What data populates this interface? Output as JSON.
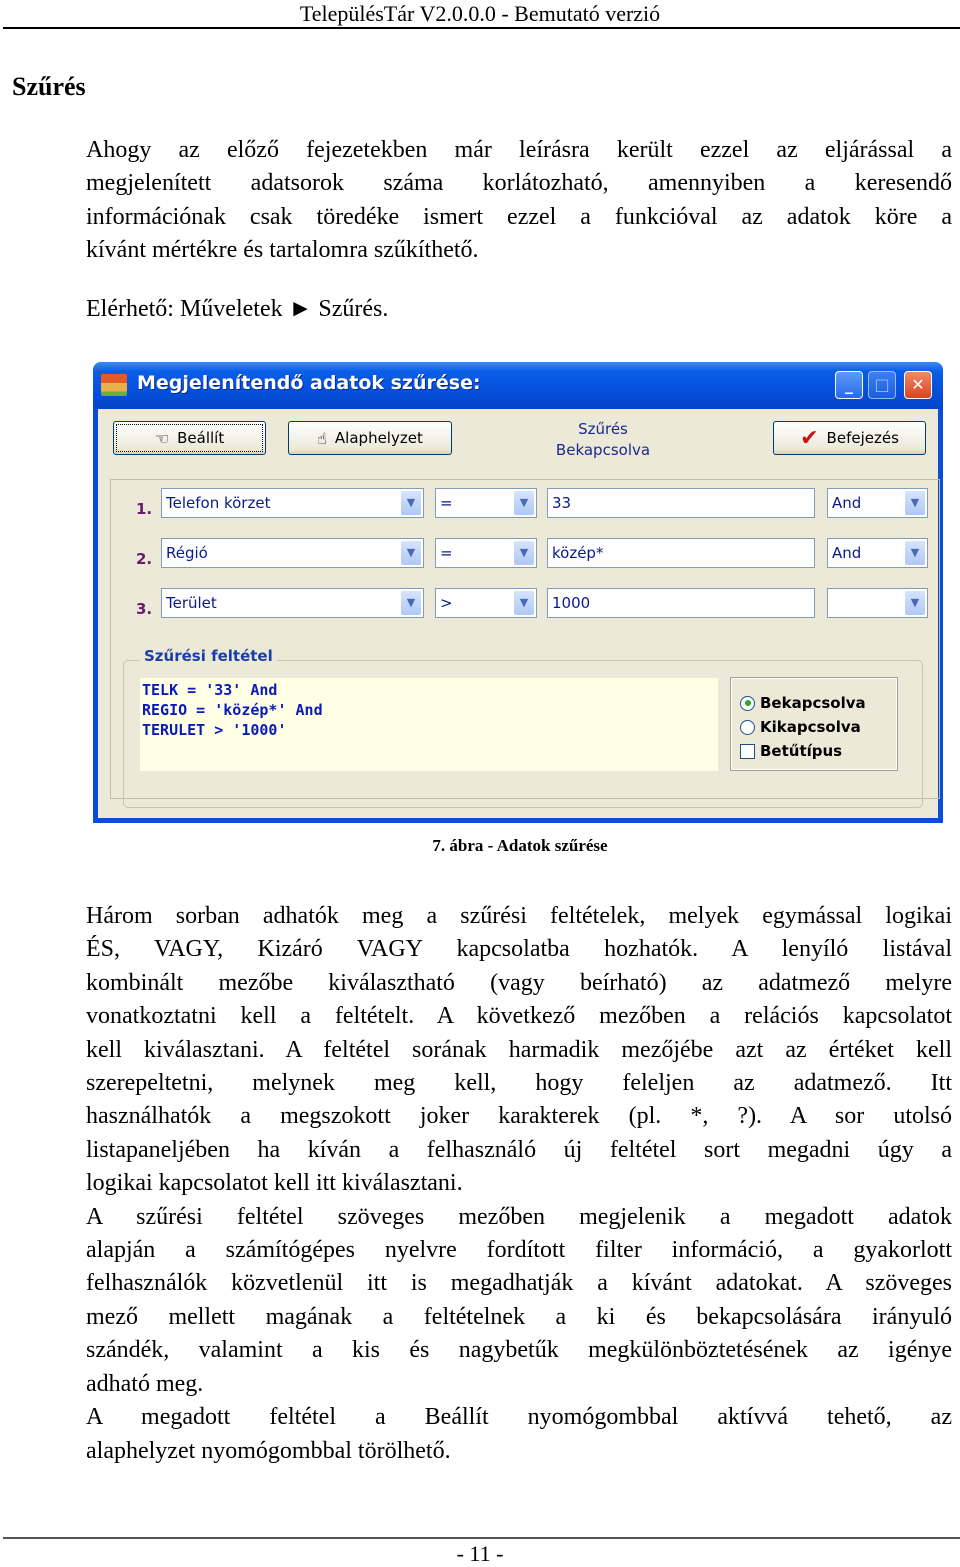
{
  "header": {
    "title": "TelepülésTár V2.0.0.0 - Bemutató verzió"
  },
  "section": {
    "title": "Szűrés"
  },
  "intro": {
    "lines": [
      "Ahogy az előző fejezetekben már leírásra került ezzel az eljárással a",
      "megjelenített adatsorok száma korlátozható, amennyiben a keresendő",
      "információnak csak töredéke ismert ezzel a funkcióval az adatok köre a",
      "kívánt mértékre és tartalomra szűkíthető."
    ],
    "access": "Elérhető: Műveletek ► Szűrés."
  },
  "dialog": {
    "title": "Megjelenítendő adatok szűrése:",
    "buttons": {
      "set": "Beállít",
      "reset": "Alaphelyzet",
      "done": "Befejezés"
    },
    "status": {
      "label": "Szűrés",
      "value": "Bekapcsolva"
    },
    "rows": [
      {
        "num": "1.",
        "field": "Telefon körzet",
        "op": "=",
        "value": "33",
        "logic": "And"
      },
      {
        "num": "2.",
        "field": "Régió",
        "op": "=",
        "value": "közép*",
        "logic": "And"
      },
      {
        "num": "3.",
        "field": "Terület",
        "op": ">",
        "value": "1000",
        "logic": ""
      }
    ],
    "filter_group": {
      "label": "Szűrési feltétel",
      "lines": [
        "TELK = '33' And",
        "REGIO = 'közép*' And",
        "TERULET > '1000'"
      ],
      "options": {
        "on": "Bekapcsolva",
        "off": "Kikapcsolva",
        "font": "Betűtípus"
      },
      "selected": "on",
      "font_checked": false
    }
  },
  "caption": "7. ábra - Adatok szűrése",
  "body": {
    "lines": [
      "Három sorban adhatók meg a szűrési feltételek, melyek egymással logikai",
      "ÉS, VAGY, Kizáró VAGY kapcsolatba hozhatók. A lenyíló listával",
      "kombinált mezőbe kiválasztható (vagy beírható) az adatmező melyre",
      "vonatkoztatni kell a feltételt. A következő mezőben a relációs kapcsolatot",
      "kell kiválasztani. A feltétel sorának harmadik mezőjébe azt az értéket kell",
      "szerepeltetni, melynek meg kell, hogy feleljen az adatmező. Itt",
      "használhatók a megszokott joker karakterek (pl. *, ?). A sor utolsó",
      "listapaneljében ha kíván a felhasználó új feltétel sort megadni úgy a",
      "logikai kapcsolatot kell itt kiválasztani.",
      "A szűrési feltétel szöveges mezőben megjelenik a megadott adatok",
      "alapján a számítógépes nyelvre fordított filter információ, a gyakorlott",
      "felhasználók közvetlenül itt is megadhatják a kívánt adatokat. A szöveges",
      "mező mellett magának a feltételnek a ki és bekapcsolására irányuló",
      "szándék, valamint a kis és nagybetűk megkülönböztetésének az igénye",
      "adható meg.",
      "A megadott feltétel a Beállít nyomógombbal aktívvá tehető, az",
      "alaphelyzet nyomógombbal törölhető."
    ]
  },
  "footer": {
    "page": "- 11 -"
  }
}
